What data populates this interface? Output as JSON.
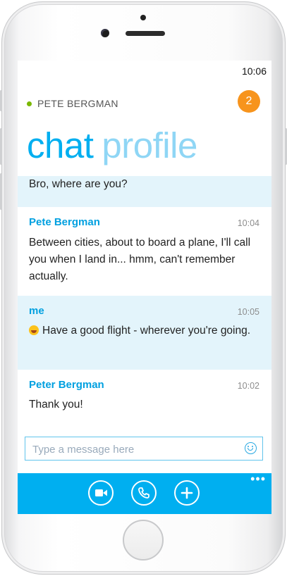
{
  "status_bar": {
    "time": "10:06"
  },
  "header": {
    "contact_name": "PETE BERGMAN",
    "notification_count": "2",
    "tabs": [
      {
        "label": "chat",
        "active": true
      },
      {
        "label": "profile",
        "active": false
      }
    ]
  },
  "messages": [
    {
      "sender": "",
      "time": "",
      "text": "Bro, where are you?",
      "from_me": true
    },
    {
      "sender": "Pete Bergman",
      "time": "10:04",
      "text": "Between cities, about to board a plane, I'll call you when I land in... hmm, can't remember actually.",
      "from_me": false
    },
    {
      "sender": "me",
      "time": "10:05",
      "text": "Have a good flight - wherever you're going.",
      "from_me": true,
      "emoji": "laughing-face"
    },
    {
      "sender": "Peter Bergman",
      "time": "10:02",
      "text": "Thank you!",
      "from_me": false
    }
  ],
  "composer": {
    "placeholder": "Type a message here",
    "value": ""
  },
  "toolbar": {
    "more_label": "•••",
    "buttons": [
      "video-call",
      "voice-call",
      "add"
    ]
  },
  "colors": {
    "accent": "#00aff0",
    "badge": "#f7941d",
    "online": "#7ab800",
    "my_bubble": "#e3f4fb"
  }
}
